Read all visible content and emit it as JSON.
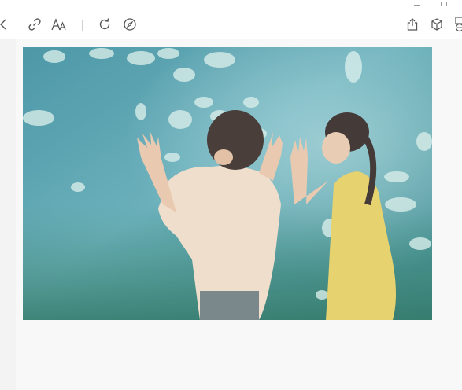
{
  "window": {
    "minimize_icon": "minimize-icon",
    "maximize_icon": "maximize-icon"
  },
  "toolbar": {
    "left_icons": [
      "chevron-left-icon",
      "link-icon",
      "text-size-icon",
      "rotate-icon",
      "compass-icon"
    ],
    "right_icons": [
      "share-icon",
      "cube-icon",
      "more-icon"
    ]
  },
  "image": {
    "subject": "children-at-aquarium",
    "colors": {
      "water_light": "#5fa6b3",
      "water_dark": "#2f7e86",
      "shirt": "#f0dcc8",
      "dress": "#e6cf5c",
      "hair": "#3a2e2a"
    }
  }
}
